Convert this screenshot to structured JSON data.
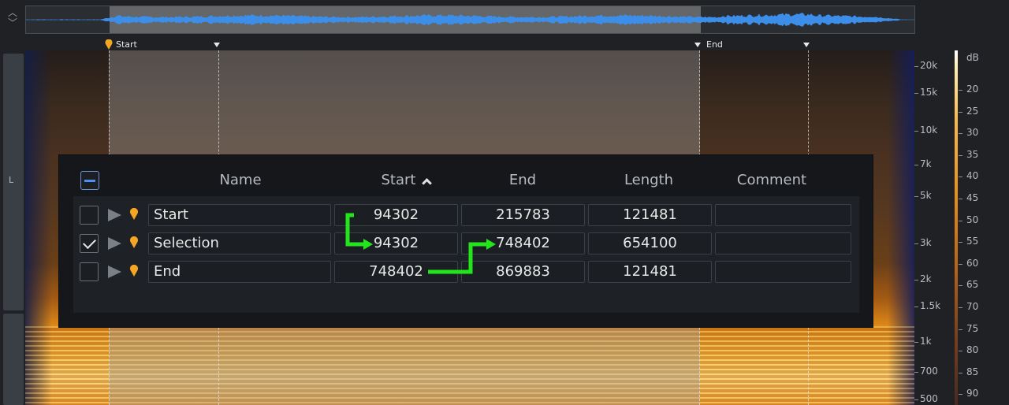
{
  "channel": {
    "label": "L"
  },
  "markers_ruler": {
    "start_label": "Start",
    "end_label": "End"
  },
  "freq_axis": {
    "labels": [
      "20k",
      "15k",
      "10k",
      "7k",
      "5k",
      "3k",
      "2k",
      "1.5k",
      "1k",
      "700",
      "500"
    ]
  },
  "db_axis": {
    "unit": "dB",
    "labels": [
      "20",
      "25",
      "30",
      "35",
      "40",
      "45",
      "50",
      "55",
      "60",
      "65",
      "70",
      "75",
      "80",
      "85",
      "90"
    ]
  },
  "marker_list": {
    "columns": {
      "name": "Name",
      "start": "Start",
      "end": "End",
      "length": "Length",
      "comment": "Comment"
    },
    "sort": {
      "column": "start",
      "direction": "ascending"
    },
    "rows": [
      {
        "checked": false,
        "name": "Start",
        "start": "94302",
        "end": "215783",
        "length": "121481",
        "comment": ""
      },
      {
        "checked": true,
        "name": "Selection",
        "start": "94302",
        "end": "748402",
        "length": "654100",
        "comment": ""
      },
      {
        "checked": false,
        "name": "End",
        "start": "748402",
        "end": "869883",
        "length": "121481",
        "comment": ""
      }
    ]
  },
  "colors": {
    "accent": "#4f8ff0",
    "marker": "#f5a623",
    "annotation": "#22e51c",
    "waveform": "#3d8ee8"
  }
}
